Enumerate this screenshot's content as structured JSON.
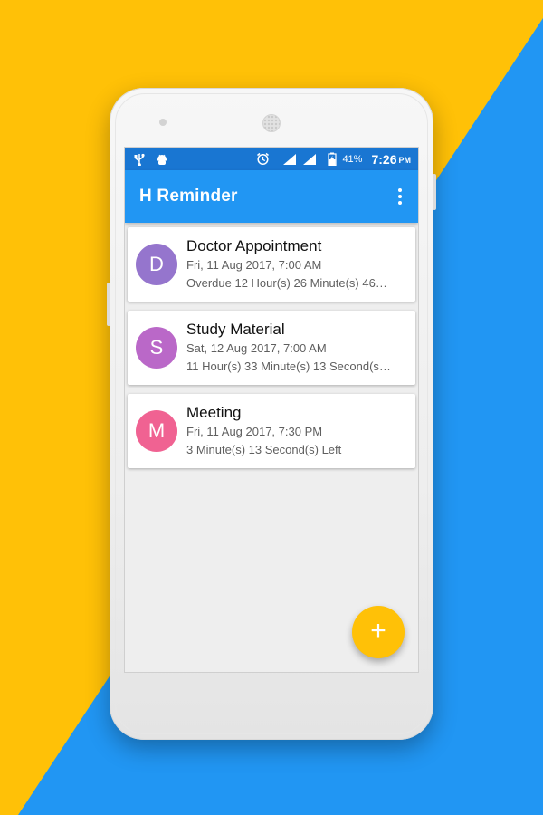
{
  "colors": {
    "background_yellow": "#FFC107",
    "background_blue": "#2196F3",
    "status_bar": "#1976D2",
    "app_bar": "#2196F3",
    "fab": "#FFC107"
  },
  "status_bar": {
    "left_icons": [
      "usb-icon",
      "android-debug-icon"
    ],
    "right_icons": [
      "alarm-icon",
      "signal-icon",
      "signal-icon",
      "battery-charging-icon"
    ],
    "battery": "41%",
    "time": "7:26",
    "ampm": "PM"
  },
  "app_bar": {
    "title": "H Reminder",
    "overflow_icon": "more-vert-icon"
  },
  "reminders": [
    {
      "initial": "D",
      "avatar_color": "#9575CD",
      "title": "Doctor Appointment",
      "date": "Fri, 11 Aug 2017, 7:00 AM",
      "remaining": "Overdue 12 Hour(s) 26 Minute(s) 46…"
    },
    {
      "initial": "S",
      "avatar_color": "#BA68C8",
      "title": "Study Material",
      "date": "Sat, 12 Aug 2017, 7:00 AM",
      "remaining": "11 Hour(s) 33 Minute(s) 13 Second(s…"
    },
    {
      "initial": "M",
      "avatar_color": "#F06292",
      "title": "Meeting",
      "date": "Fri, 11 Aug 2017, 7:30 PM",
      "remaining": "3 Minute(s) 13 Second(s)  Left"
    }
  ],
  "fab": {
    "label": "+",
    "icon": "add-icon"
  }
}
